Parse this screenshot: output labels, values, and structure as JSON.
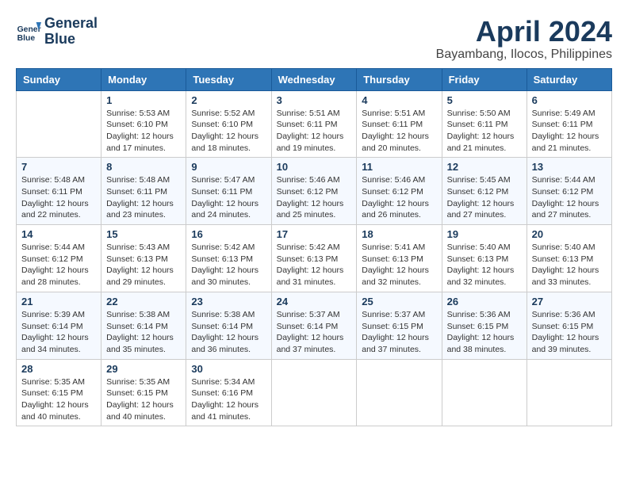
{
  "header": {
    "logo_line1": "General",
    "logo_line2": "Blue",
    "month": "April 2024",
    "location": "Bayambang, Ilocos, Philippines"
  },
  "days_of_week": [
    "Sunday",
    "Monday",
    "Tuesday",
    "Wednesday",
    "Thursday",
    "Friday",
    "Saturday"
  ],
  "weeks": [
    [
      {
        "day": "",
        "sunrise": "",
        "sunset": "",
        "daylight": ""
      },
      {
        "day": "1",
        "sunrise": "Sunrise: 5:53 AM",
        "sunset": "Sunset: 6:10 PM",
        "daylight": "Daylight: 12 hours and 17 minutes."
      },
      {
        "day": "2",
        "sunrise": "Sunrise: 5:52 AM",
        "sunset": "Sunset: 6:10 PM",
        "daylight": "Daylight: 12 hours and 18 minutes."
      },
      {
        "day": "3",
        "sunrise": "Sunrise: 5:51 AM",
        "sunset": "Sunset: 6:11 PM",
        "daylight": "Daylight: 12 hours and 19 minutes."
      },
      {
        "day": "4",
        "sunrise": "Sunrise: 5:51 AM",
        "sunset": "Sunset: 6:11 PM",
        "daylight": "Daylight: 12 hours and 20 minutes."
      },
      {
        "day": "5",
        "sunrise": "Sunrise: 5:50 AM",
        "sunset": "Sunset: 6:11 PM",
        "daylight": "Daylight: 12 hours and 21 minutes."
      },
      {
        "day": "6",
        "sunrise": "Sunrise: 5:49 AM",
        "sunset": "Sunset: 6:11 PM",
        "daylight": "Daylight: 12 hours and 21 minutes."
      }
    ],
    [
      {
        "day": "7",
        "sunrise": "Sunrise: 5:48 AM",
        "sunset": "Sunset: 6:11 PM",
        "daylight": "Daylight: 12 hours and 22 minutes."
      },
      {
        "day": "8",
        "sunrise": "Sunrise: 5:48 AM",
        "sunset": "Sunset: 6:11 PM",
        "daylight": "Daylight: 12 hours and 23 minutes."
      },
      {
        "day": "9",
        "sunrise": "Sunrise: 5:47 AM",
        "sunset": "Sunset: 6:11 PM",
        "daylight": "Daylight: 12 hours and 24 minutes."
      },
      {
        "day": "10",
        "sunrise": "Sunrise: 5:46 AM",
        "sunset": "Sunset: 6:12 PM",
        "daylight": "Daylight: 12 hours and 25 minutes."
      },
      {
        "day": "11",
        "sunrise": "Sunrise: 5:46 AM",
        "sunset": "Sunset: 6:12 PM",
        "daylight": "Daylight: 12 hours and 26 minutes."
      },
      {
        "day": "12",
        "sunrise": "Sunrise: 5:45 AM",
        "sunset": "Sunset: 6:12 PM",
        "daylight": "Daylight: 12 hours and 27 minutes."
      },
      {
        "day": "13",
        "sunrise": "Sunrise: 5:44 AM",
        "sunset": "Sunset: 6:12 PM",
        "daylight": "Daylight: 12 hours and 27 minutes."
      }
    ],
    [
      {
        "day": "14",
        "sunrise": "Sunrise: 5:44 AM",
        "sunset": "Sunset: 6:12 PM",
        "daylight": "Daylight: 12 hours and 28 minutes."
      },
      {
        "day": "15",
        "sunrise": "Sunrise: 5:43 AM",
        "sunset": "Sunset: 6:13 PM",
        "daylight": "Daylight: 12 hours and 29 minutes."
      },
      {
        "day": "16",
        "sunrise": "Sunrise: 5:42 AM",
        "sunset": "Sunset: 6:13 PM",
        "daylight": "Daylight: 12 hours and 30 minutes."
      },
      {
        "day": "17",
        "sunrise": "Sunrise: 5:42 AM",
        "sunset": "Sunset: 6:13 PM",
        "daylight": "Daylight: 12 hours and 31 minutes."
      },
      {
        "day": "18",
        "sunrise": "Sunrise: 5:41 AM",
        "sunset": "Sunset: 6:13 PM",
        "daylight": "Daylight: 12 hours and 32 minutes."
      },
      {
        "day": "19",
        "sunrise": "Sunrise: 5:40 AM",
        "sunset": "Sunset: 6:13 PM",
        "daylight": "Daylight: 12 hours and 32 minutes."
      },
      {
        "day": "20",
        "sunrise": "Sunrise: 5:40 AM",
        "sunset": "Sunset: 6:13 PM",
        "daylight": "Daylight: 12 hours and 33 minutes."
      }
    ],
    [
      {
        "day": "21",
        "sunrise": "Sunrise: 5:39 AM",
        "sunset": "Sunset: 6:14 PM",
        "daylight": "Daylight: 12 hours and 34 minutes."
      },
      {
        "day": "22",
        "sunrise": "Sunrise: 5:38 AM",
        "sunset": "Sunset: 6:14 PM",
        "daylight": "Daylight: 12 hours and 35 minutes."
      },
      {
        "day": "23",
        "sunrise": "Sunrise: 5:38 AM",
        "sunset": "Sunset: 6:14 PM",
        "daylight": "Daylight: 12 hours and 36 minutes."
      },
      {
        "day": "24",
        "sunrise": "Sunrise: 5:37 AM",
        "sunset": "Sunset: 6:14 PM",
        "daylight": "Daylight: 12 hours and 37 minutes."
      },
      {
        "day": "25",
        "sunrise": "Sunrise: 5:37 AM",
        "sunset": "Sunset: 6:15 PM",
        "daylight": "Daylight: 12 hours and 37 minutes."
      },
      {
        "day": "26",
        "sunrise": "Sunrise: 5:36 AM",
        "sunset": "Sunset: 6:15 PM",
        "daylight": "Daylight: 12 hours and 38 minutes."
      },
      {
        "day": "27",
        "sunrise": "Sunrise: 5:36 AM",
        "sunset": "Sunset: 6:15 PM",
        "daylight": "Daylight: 12 hours and 39 minutes."
      }
    ],
    [
      {
        "day": "28",
        "sunrise": "Sunrise: 5:35 AM",
        "sunset": "Sunset: 6:15 PM",
        "daylight": "Daylight: 12 hours and 40 minutes."
      },
      {
        "day": "29",
        "sunrise": "Sunrise: 5:35 AM",
        "sunset": "Sunset: 6:15 PM",
        "daylight": "Daylight: 12 hours and 40 minutes."
      },
      {
        "day": "30",
        "sunrise": "Sunrise: 5:34 AM",
        "sunset": "Sunset: 6:16 PM",
        "daylight": "Daylight: 12 hours and 41 minutes."
      },
      {
        "day": "",
        "sunrise": "",
        "sunset": "",
        "daylight": ""
      },
      {
        "day": "",
        "sunrise": "",
        "sunset": "",
        "daylight": ""
      },
      {
        "day": "",
        "sunrise": "",
        "sunset": "",
        "daylight": ""
      },
      {
        "day": "",
        "sunrise": "",
        "sunset": "",
        "daylight": ""
      }
    ]
  ]
}
